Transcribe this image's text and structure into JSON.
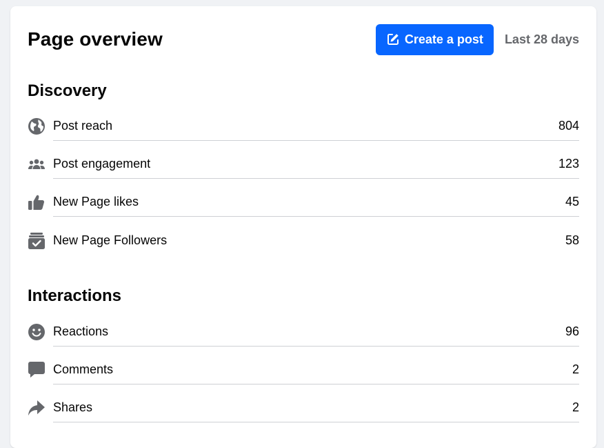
{
  "header": {
    "title": "Page overview",
    "create_post_label": "Create a post",
    "period_label": "Last 28 days"
  },
  "discovery": {
    "title": "Discovery",
    "items": [
      {
        "icon": "globe-icon",
        "label": "Post reach",
        "value": "804"
      },
      {
        "icon": "people-icon",
        "label": "Post engagement",
        "value": "123"
      },
      {
        "icon": "thumbs-up-icon",
        "label": "New Page likes",
        "value": "45"
      },
      {
        "icon": "followers-check-icon",
        "label": "New Page Followers",
        "value": "58"
      }
    ]
  },
  "interactions": {
    "title": "Interactions",
    "items": [
      {
        "icon": "smiley-icon",
        "label": "Reactions",
        "value": "96"
      },
      {
        "icon": "comment-icon",
        "label": "Comments",
        "value": "2"
      },
      {
        "icon": "share-arrow-icon",
        "label": "Shares",
        "value": "2"
      }
    ]
  },
  "colors": {
    "accent": "#0866ff",
    "icon": "#65676b",
    "text": "#050505",
    "divider": "#ced0d4"
  }
}
